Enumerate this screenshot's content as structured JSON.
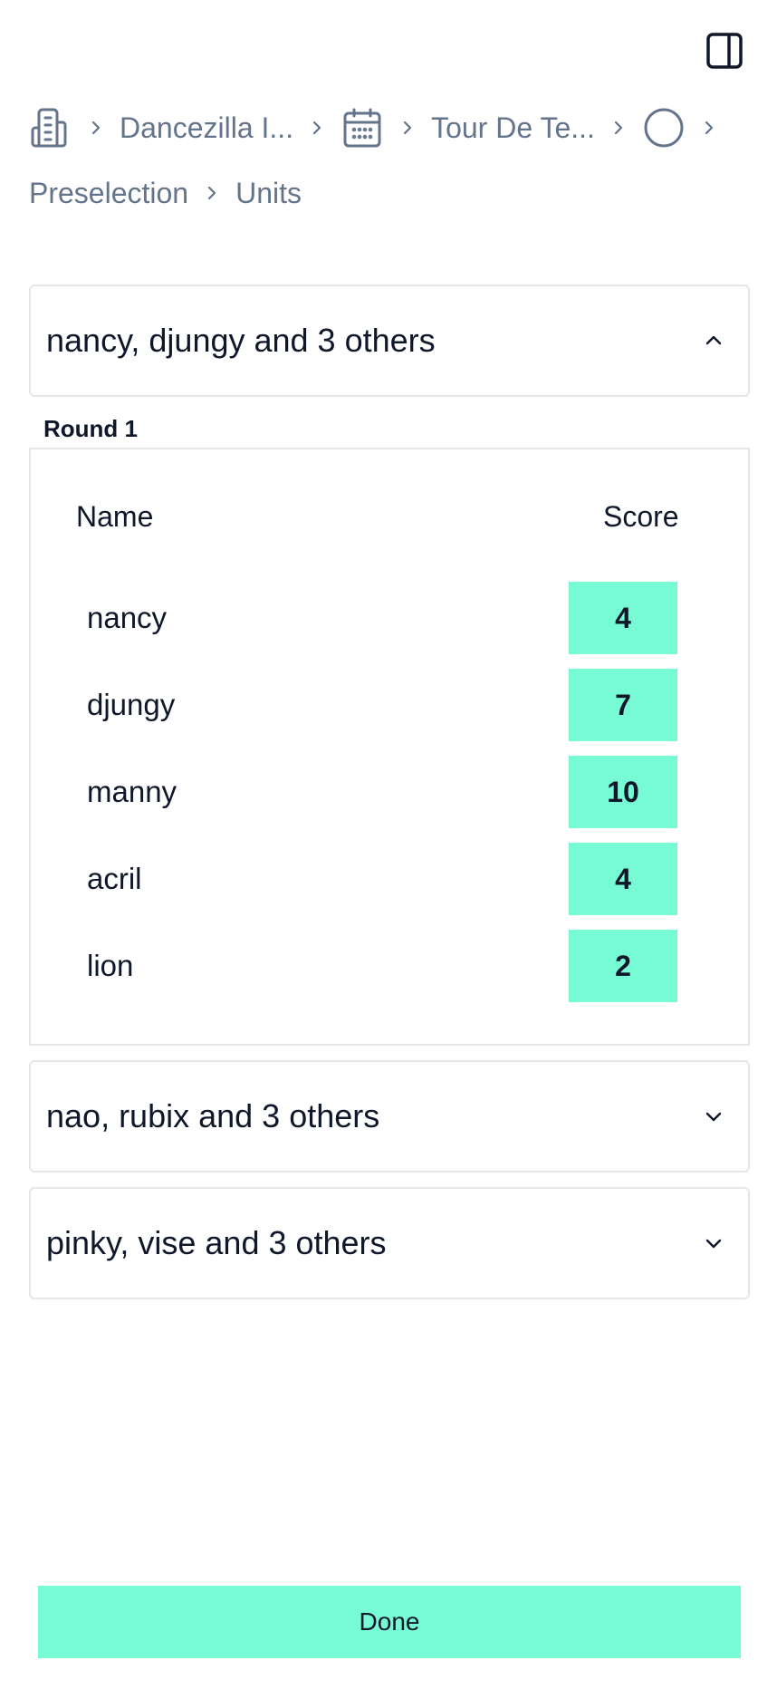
{
  "topbar": {
    "panel_toggle_icon": "panel-toggle-icon"
  },
  "breadcrumb": {
    "items": [
      {
        "icon": "building-icon",
        "label": "Dancezilla I..."
      },
      {
        "icon": "calendar-icon",
        "label": "Tour De Te..."
      },
      {
        "icon": "circle-icon",
        "label": ""
      },
      {
        "icon": "",
        "label": "Preselection"
      },
      {
        "icon": "",
        "label": "Units"
      }
    ],
    "separator_icon": "chevron-right-icon"
  },
  "groups": [
    {
      "title": "nancy, djungy and 3 others",
      "expanded": true,
      "round_label": "Round 1",
      "columns": {
        "name": "Name",
        "score": "Score"
      },
      "rows": [
        {
          "name": "nancy",
          "score": "4"
        },
        {
          "name": "djungy",
          "score": "7"
        },
        {
          "name": "manny",
          "score": "10"
        },
        {
          "name": "acril",
          "score": "4"
        },
        {
          "name": "lion",
          "score": "2"
        }
      ]
    },
    {
      "title": "nao, rubix and 3 others",
      "expanded": false
    },
    {
      "title": "pinky, vise and 3 others",
      "expanded": false
    }
  ],
  "footer": {
    "done_label": "Done"
  },
  "colors": {
    "accent": "#76fbd4",
    "muted_text": "#64748b",
    "border": "#e5e7eb",
    "text": "#0f172a"
  }
}
